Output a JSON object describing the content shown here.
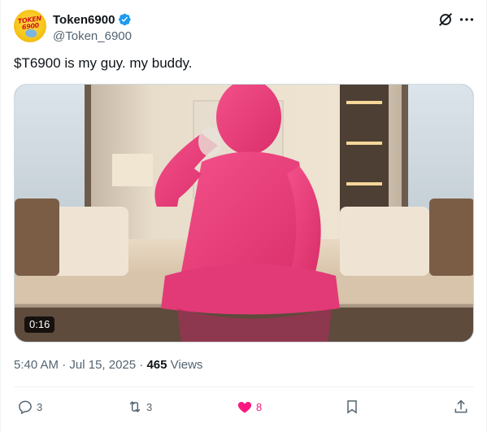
{
  "author": {
    "display_name": "Token6900",
    "handle": "@Token_6900",
    "avatar_text": "TOKEN 6900",
    "verified": true
  },
  "icons": {
    "header": [
      "grok-icon",
      "more-icon"
    ],
    "actions": [
      "reply-icon",
      "retweet-icon",
      "like-icon",
      "bookmark-icon",
      "share-icon"
    ]
  },
  "tweet": {
    "text": "$T6900 is my guy. my buddy."
  },
  "media": {
    "type": "video",
    "duration": "0:16"
  },
  "meta": {
    "time": "5:40 AM",
    "separator1": "·",
    "date": "Jul 15, 2025",
    "separator2": "·",
    "views_count": "465",
    "views_label": "Views"
  },
  "actions": {
    "replies": "3",
    "retweets": "3",
    "likes": "8"
  },
  "colors": {
    "accent_like": "#f91880",
    "verified_blue": "#1d9bf0",
    "muted_text": "#536471"
  }
}
